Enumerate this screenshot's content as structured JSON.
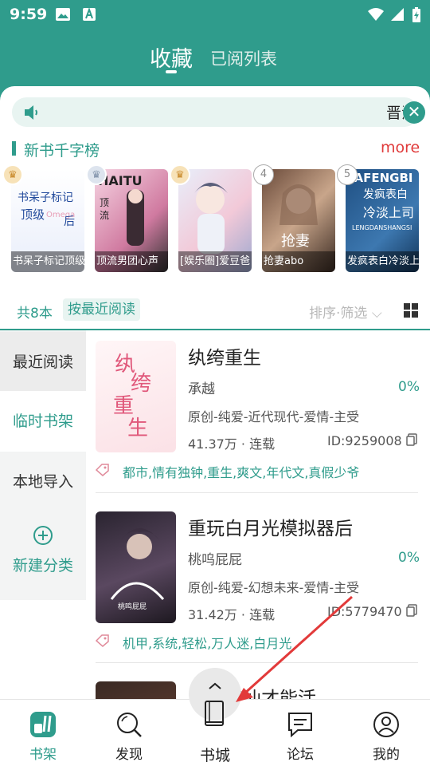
{
  "status_bar": {
    "time": "9:59"
  },
  "header": {
    "tabs": [
      {
        "label": "收藏",
        "active": true
      },
      {
        "label": "已阅列表",
        "active": false
      }
    ]
  },
  "notice": {
    "text": "晋江"
  },
  "ranking": {
    "title": "新书千字榜",
    "more": "more",
    "books": [
      {
        "rank": 1,
        "caption": "书呆子标记顶级",
        "cover_text": "书呆子标记顶级Omega后"
      },
      {
        "rank": 2,
        "caption": "顶流男团心声",
        "cover_text": "HAITU 顶流"
      },
      {
        "rank": 3,
        "caption": "[娱乐圈]爱豆爸",
        "cover_text": ""
      },
      {
        "rank": 4,
        "caption": "抢妻abo",
        "cover_text": "抢妻"
      },
      {
        "rank": 5,
        "caption": "发疯表白冷淡上司",
        "cover_text": "FAFENGBI 发疯表白 冷淡上司 LENGDANSHANGSI"
      }
    ]
  },
  "filter": {
    "count": "共8本",
    "sort_mode": "按最近阅读",
    "sort_filter": "排序·筛选"
  },
  "sidebar": {
    "items": [
      "最近阅读",
      "临时书架",
      "本地导入"
    ],
    "new_category": "新建分类"
  },
  "books": [
    {
      "title": "纨绔重生",
      "author": "承越",
      "progress": "0%",
      "genre": "原创-纯爱-近代现代-爱情-主受",
      "stats": "41.37万 · 连载",
      "id": "ID:9259008",
      "tags": "都市,情有独钟,重生,爽文,年代文,真假少爷",
      "cover_text": "纨绔重生"
    },
    {
      "title": "重玩白月光模拟器后",
      "author": "桃呜屁屁",
      "progress": "0%",
      "genre": "原创-纯爱-幻想未来-爱情-主受",
      "stats": "31.42万 · 连载",
      "id": "ID:5779470",
      "tags": "机甲,系统,轻松,万人迷,白月光",
      "cover_text": ""
    },
    {
      "title": "只能修仙才能活",
      "author": "",
      "progress": "",
      "genre": "",
      "stats": "",
      "id": "",
      "tags": "",
      "cover_text": ""
    }
  ],
  "bottom_nav": {
    "items": [
      {
        "label": "书架",
        "icon": "bookshelf-icon",
        "active": true
      },
      {
        "label": "发现",
        "icon": "search-icon",
        "active": false
      },
      {
        "label": "书城",
        "icon": "book-icon",
        "active": false
      },
      {
        "label": "论坛",
        "icon": "chat-icon",
        "active": false
      },
      {
        "label": "我的",
        "icon": "user-icon",
        "active": false
      }
    ]
  },
  "colors": {
    "accent": "#2f9c8c",
    "more": "#e03a3a",
    "annotation_arrow": "#e23a3a"
  }
}
